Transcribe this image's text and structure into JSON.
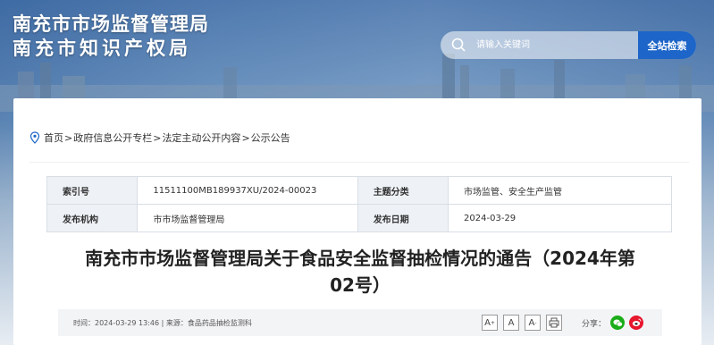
{
  "header": {
    "title_line1": "南充市市场监督管理局",
    "title_line2": "南充市知识产权局",
    "search_placeholder": "请输入关键词",
    "search_button": "全站检索"
  },
  "breadcrumb": {
    "items": [
      "首页",
      "政府信息公开专栏",
      "法定主动公开内容",
      "公示公告"
    ],
    "separator": ">"
  },
  "info_table": {
    "index_label": "索引号",
    "index_value": "11511100MB189937XU/2024-00023",
    "category_label": "主题分类",
    "category_value": "市场监管、安全生产监管",
    "publisher_label": "发布机构",
    "publisher_value": "市市场监督管理局",
    "date_label": "发布日期",
    "date_value": "2024-03-29"
  },
  "article": {
    "title_line1": "南充市市场监督管理局关于食品安全监督抽检情况的通告（2024年第",
    "title_line2": "02号）",
    "meta": "时间：2024-03-29 13:46  |  来源：食品药品抽检监测科"
  },
  "tools": {
    "font_increase": "A",
    "font_normal": "A",
    "font_decrease": "A",
    "share_label": "分享："
  },
  "colors": {
    "accent": "#1d65c8",
    "table_key_bg": "#eef2f7",
    "wechat": "#1aad19",
    "weibo": "#e6162d"
  }
}
